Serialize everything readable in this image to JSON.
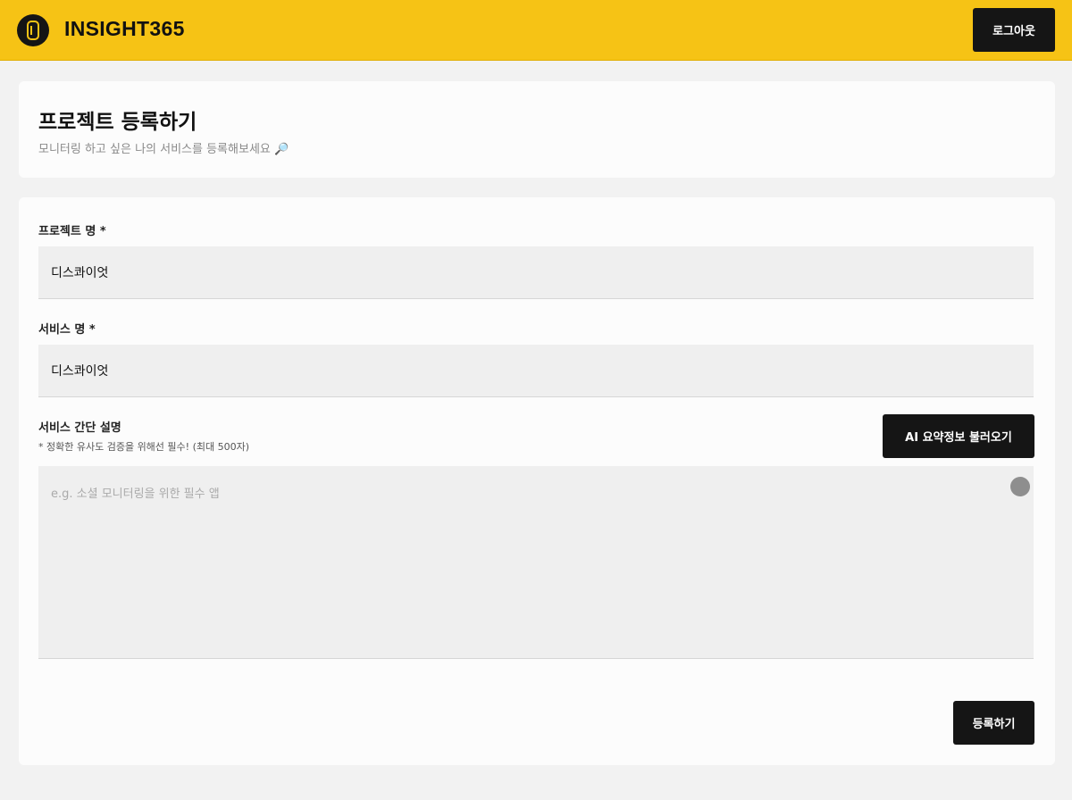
{
  "header": {
    "app_name": "INSIGHT365",
    "logo_icon": "insight-logo-icon",
    "logout_label": "로그아웃",
    "brand_color": "#f6c315"
  },
  "page": {
    "title": "프로젝트 등록하기",
    "subtitle": "모니터링 하고 싶은 나의 서비스를 등록해보세요 🔎"
  },
  "form": {
    "project_name": {
      "label": "프로젝트 명 *",
      "value": "디스콰이엇"
    },
    "service_name": {
      "label": "서비스 명 *",
      "value": "디스콰이엇"
    },
    "description": {
      "label": "서비스 간단 설명",
      "hint": "* 정확한 유사도 검증을 위해선 필수! (최대 500자)",
      "placeholder": "e.g. 소셜 모니터링을 위한 필수 앱",
      "value": ""
    },
    "ai_button_label": "AI 요약정보 불러오기",
    "submit_label": "등록하기"
  }
}
